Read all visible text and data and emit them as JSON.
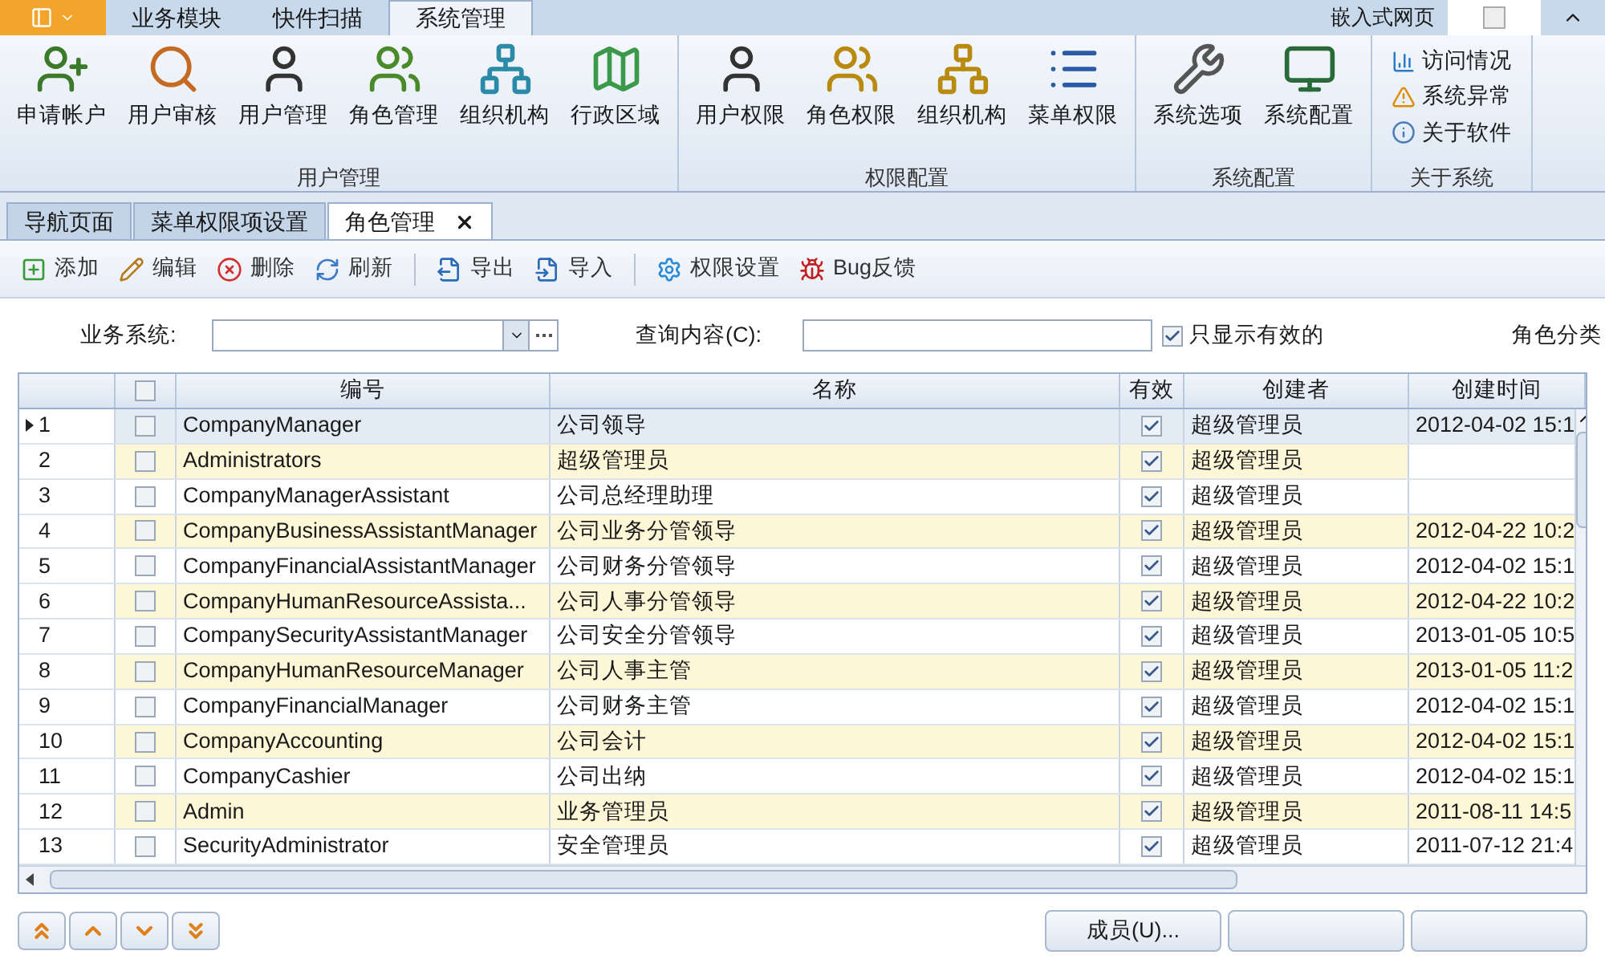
{
  "ribbon_tabs": [
    {
      "label": "业务模块",
      "selected": false
    },
    {
      "label": "快件扫描",
      "selected": false
    },
    {
      "label": "系统管理",
      "selected": true
    }
  ],
  "ribbon_right": {
    "label": "嵌入式网页"
  },
  "ribbon_groups": [
    {
      "title": "用户管理",
      "kind": "large",
      "items": [
        {
          "label": "申请帐户"
        },
        {
          "label": "用户审核"
        },
        {
          "label": "用户管理"
        },
        {
          "label": "角色管理"
        },
        {
          "label": "组织机构"
        },
        {
          "label": "行政区域"
        }
      ]
    },
    {
      "title": "权限配置",
      "kind": "large",
      "items": [
        {
          "label": "用户权限"
        },
        {
          "label": "角色权限"
        },
        {
          "label": "组织机构"
        },
        {
          "label": "菜单权限"
        }
      ]
    },
    {
      "title": "系统配置",
      "kind": "large",
      "items": [
        {
          "label": "系统选项"
        },
        {
          "label": "系统配置"
        }
      ]
    },
    {
      "title": "关于系统",
      "kind": "small",
      "items": [
        {
          "label": "访问情况"
        },
        {
          "label": "系统异常"
        },
        {
          "label": "关于软件"
        }
      ]
    }
  ],
  "doc_tabs": [
    {
      "label": "导航页面",
      "selected": false,
      "closable": false
    },
    {
      "label": "菜单权限项设置",
      "selected": false,
      "closable": false
    },
    {
      "label": "角色管理",
      "selected": true,
      "closable": true
    }
  ],
  "toolbar": [
    {
      "label": "添加",
      "separator_before": false
    },
    {
      "label": "编辑",
      "separator_before": false
    },
    {
      "label": "删除",
      "separator_before": false
    },
    {
      "label": "刷新",
      "separator_before": false
    },
    {
      "label": "导出",
      "separator_before": true
    },
    {
      "label": "导入",
      "separator_before": false
    },
    {
      "label": "权限设置",
      "separator_before": true
    },
    {
      "label": "Bug反馈",
      "separator_before": false
    }
  ],
  "filter": {
    "system_label": "业务系统:",
    "query_label": "查询内容(C):",
    "valid_only": {
      "label": "只显示有效的",
      "checked": true
    },
    "category_label": "角色分类"
  },
  "table": {
    "all_checked": false,
    "columns": [
      "编号",
      "名称",
      "有效",
      "创建者",
      "创建时间"
    ],
    "rows": [
      {
        "num": "1",
        "code": "CompanyManager",
        "name": "公司领导",
        "valid": true,
        "creator": "超级管理员",
        "time": "2012-04-02 15:1",
        "selected": true,
        "checked": false
      },
      {
        "num": "2",
        "code": "Administrators",
        "name": "超级管理员",
        "valid": true,
        "creator": "超级管理员",
        "selected": false,
        "checked": false
      },
      {
        "num": "3",
        "code": "CompanyManagerAssistant",
        "name": "公司总经理助理",
        "valid": true,
        "creator": "超级管理员",
        "selected": false,
        "checked": false
      },
      {
        "num": "4",
        "code": "CompanyBusinessAssistantManager",
        "name": "公司业务分管领导",
        "valid": true,
        "creator": "超级管理员",
        "time": "2012-04-22 10:2",
        "selected": false,
        "checked": false
      },
      {
        "num": "5",
        "code": "CompanyFinancialAssistantManager",
        "name": "公司财务分管领导",
        "valid": true,
        "creator": "超级管理员",
        "time": "2012-04-02 15:1",
        "selected": false,
        "checked": false
      },
      {
        "num": "6",
        "code": "CompanyHumanResourceAssista...",
        "name": "公司人事分管领导",
        "valid": true,
        "creator": "超级管理员",
        "time": "2012-04-22 10:2",
        "selected": false,
        "checked": false
      },
      {
        "num": "7",
        "code": "CompanySecurityAssistantManager",
        "name": "公司安全分管领导",
        "valid": true,
        "creator": "超级管理员",
        "time": "2013-01-05 10:5",
        "selected": false,
        "checked": false
      },
      {
        "num": "8",
        "code": "CompanyHumanResourceManager",
        "name": "公司人事主管",
        "valid": true,
        "creator": "超级管理员",
        "time": "2013-01-05 11:2",
        "selected": false,
        "checked": false
      },
      {
        "num": "9",
        "code": "CompanyFinancialManager",
        "name": "公司财务主管",
        "valid": true,
        "creator": "超级管理员",
        "time": "2012-04-02 15:1",
        "selected": false,
        "checked": false
      },
      {
        "num": "10",
        "code": "CompanyAccounting",
        "name": "公司会计",
        "valid": true,
        "creator": "超级管理员",
        "time": "2012-04-02 15:1",
        "selected": false,
        "checked": false
      },
      {
        "num": "11",
        "code": "CompanyCashier",
        "name": "公司出纳",
        "valid": true,
        "creator": "超级管理员",
        "time": "2012-04-02 15:1",
        "selected": false,
        "checked": false
      },
      {
        "num": "12",
        "code": "Admin",
        "name": "业务管理员",
        "valid": true,
        "creator": "超级管理员",
        "time": "2011-08-11 14:5",
        "selected": false,
        "checked": false
      },
      {
        "num": "13",
        "code": "SecurityAdministrator",
        "name": "安全管理员",
        "valid": true,
        "creator": "超级管理员",
        "time": "2011-07-12 21:4",
        "selected": false,
        "checked": false
      }
    ]
  },
  "bottom_buttons": [
    {
      "kind": "labeled",
      "label": "成员(U)..."
    },
    {
      "kind": "blank"
    },
    {
      "kind": "blank"
    }
  ]
}
